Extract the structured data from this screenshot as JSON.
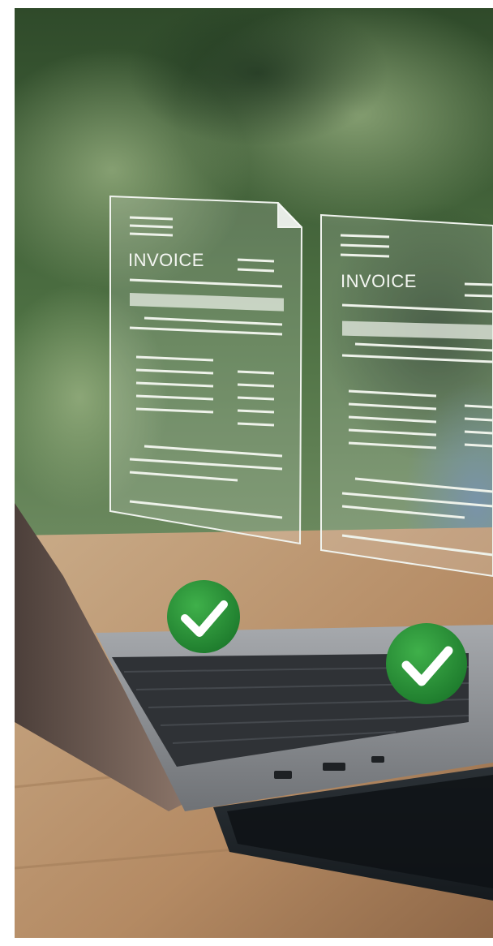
{
  "photo": {
    "documents": [
      {
        "title": "INVOICE"
      },
      {
        "title": "INVOICE"
      }
    ]
  }
}
